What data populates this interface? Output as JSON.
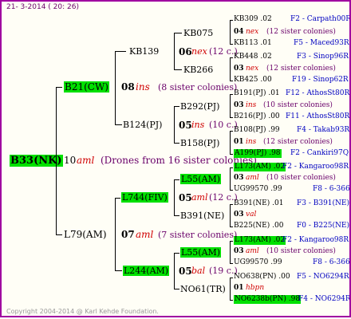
{
  "header": {
    "date": "21-  3-2014 ( 20: 26)"
  },
  "footer": {
    "copyright": "Copyright 2004-2014 @ Karl Kehde Foundation."
  },
  "colors": {
    "border": "#a000a0",
    "highlight": "#00e000",
    "year_code": "#d00000",
    "note": "#6a006a",
    "id_color": "#0000c0"
  },
  "root": {
    "name": "B33(NK)",
    "gen": "10",
    "code": "aml",
    "note": "(Drones from 16 sister colonies)"
  },
  "sire": {
    "name": "B21(CW)",
    "gen": "08",
    "code": "ins",
    "note": "(8 sister colonies)"
  },
  "dam": {
    "name": "L79(AM)",
    "gen": "07",
    "code": "aml",
    "note": "(7 sister colonies)"
  },
  "g3": [
    {
      "name": "KB139",
      "gen": "06",
      "code": "nex",
      "note": "(12 c.)"
    },
    {
      "name": "B124(PJ)",
      "gen": "05",
      "code": "ins",
      "note": "(10 c.)"
    },
    {
      "name": "L744(FIV)",
      "gen": "05",
      "code": "aml",
      "note": "(12 c.)"
    },
    {
      "name": "L244(AM)",
      "gen": "05",
      "code": "bal",
      "note": "(19 c.)"
    }
  ],
  "g4": [
    "KB075",
    "KB266",
    "B292(PJ)",
    "B158(PJ)",
    "L55(AM)",
    "B391(NE)",
    "L55(AM)",
    "NO61(TR)"
  ],
  "leaves": [
    {
      "top": "KB309 .02",
      "topid": "F2 - Carpath00R",
      "mid_gen": "04",
      "mid_code": "nex",
      "mid_note": "(12 sister colonies)",
      "bottom": "KB113 .01",
      "bottomid": "F5 - Maced93R"
    },
    {
      "top": "KB448 .02",
      "topid": "F3 - Sinop96R",
      "mid_gen": "03",
      "mid_code": "nex",
      "mid_note": "(12 sister colonies)",
      "bottom": "KB425 .00",
      "bottomid": "F19 - Sinop62R"
    },
    {
      "top": "B191(PJ) .01",
      "topid": "F12 - AthosSt80R",
      "mid_gen": "03",
      "mid_code": "ins",
      "mid_note": "(10 sister colonies)",
      "bottom": "B216(PJ) .00",
      "bottomid": "F11 - AthosSt80R"
    },
    {
      "top": "B108(PJ) .99",
      "topid": "F4 - Takab93R",
      "mid_gen": "01",
      "mid_code": "ins",
      "mid_note": "(12 sister colonies)",
      "bottom": "A199(PJ) .98",
      "bottomid": "F2 - Cankiri97Q"
    },
    {
      "top": "L173(AM) .02",
      "topid": "F2 - Kangaroo98R",
      "mid_gen": "03",
      "mid_code": "aml",
      "mid_note": "(10 sister colonies)",
      "bottom": "UG99570 .99",
      "bottomid": "F8 - 6-366"
    },
    {
      "top": "B391(NE) .01",
      "topid": "F3 - B391(NE)",
      "mid_gen": "03",
      "mid_code": "val",
      "mid_note": "",
      "bottom": "B225(NE) .00",
      "bottomid": "F0 - B225(NE)"
    },
    {
      "top": "L173(AM) .02",
      "topid": "F2 - Kangaroo98R",
      "mid_gen": "03",
      "mid_code": "aml",
      "mid_note": "(10 sister colonies)",
      "bottom": "UG99570 .99",
      "bottomid": "F8 - 6-366"
    },
    {
      "top": "NO638(PN) .00",
      "topid": "F5 - NO6294R",
      "mid_gen": "01",
      "mid_code": "hbpn",
      "mid_note": "",
      "bottom": "NO6238b(PN) .98",
      "bottomid": "F4 - NO6294R"
    }
  ]
}
